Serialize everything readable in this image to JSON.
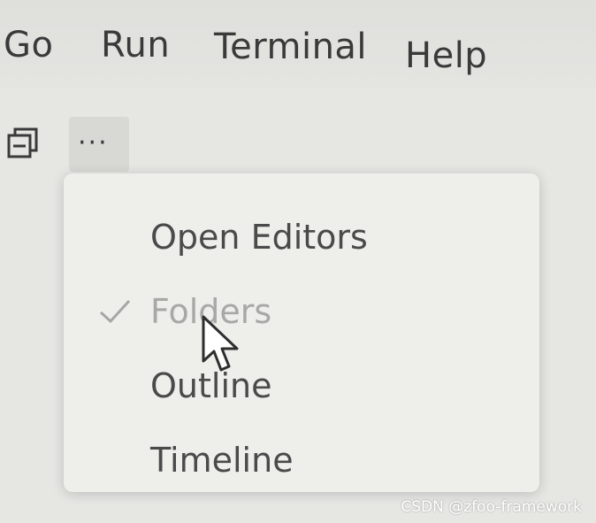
{
  "menubar": {
    "items": [
      {
        "label": "Go"
      },
      {
        "label": "Run"
      },
      {
        "label": "Terminal"
      },
      {
        "label": "Help"
      }
    ]
  },
  "toolbar": {
    "collapse_icon": "collapse-all-icon",
    "more_label": "···"
  },
  "context_menu": {
    "items": [
      {
        "label": "Open Editors",
        "checked": false
      },
      {
        "label": "Folders",
        "checked": true
      },
      {
        "label": "Outline",
        "checked": false
      },
      {
        "label": "Timeline",
        "checked": false
      }
    ]
  },
  "watermark": {
    "text": "CSDN @zfoo-framework"
  },
  "colors": {
    "background": "#e6e6e3",
    "menu_background": "#eeeeeb",
    "text": "#4a4a4a",
    "disabled_text": "#a8a8a6"
  }
}
